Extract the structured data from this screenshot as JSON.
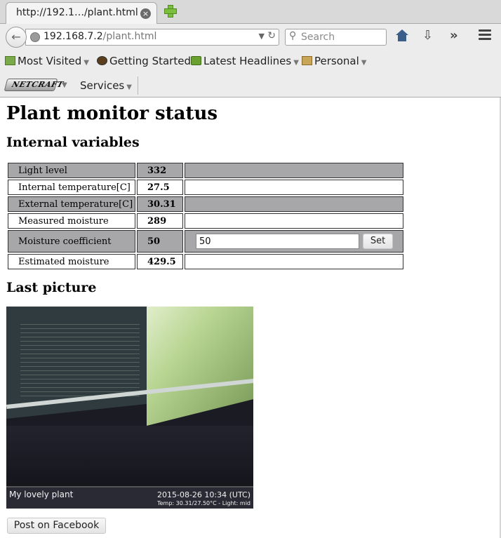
{
  "browser": {
    "tab_title": "http://192.1…/plant.html",
    "tab_close": "×",
    "url_host": "192.168.7.2",
    "url_path": "/plant.html",
    "search_placeholder": "Search",
    "bookmarks": [
      {
        "label": "Most Visited",
        "has_menu": true
      },
      {
        "label": "Getting Started",
        "has_menu": false
      },
      {
        "label": "Latest Headlines",
        "has_menu": true
      },
      {
        "label": "Personal",
        "has_menu": true
      }
    ],
    "netcraft_label": "NETCRAFT",
    "services_label": "Services",
    "icons": {
      "back": "back-arrow-icon",
      "globe": "globe-icon",
      "reload": "reload-icon",
      "search": "search-icon",
      "home": "home-icon",
      "download": "download-icon",
      "overflow": "overflow-chevron-icon",
      "menu": "hamburger-menu-icon"
    }
  },
  "page": {
    "title": "Plant monitor status",
    "section_internal": "Internal variables",
    "section_picture": "Last picture",
    "variables": [
      {
        "label": "Light level",
        "value": "332"
      },
      {
        "label": "Internal temperature[C]",
        "value": "27.5"
      },
      {
        "label": "External temperature[C]",
        "value": "30.31"
      },
      {
        "label": "Measured moisture",
        "value": "289"
      },
      {
        "label": "Moisture coefficient",
        "value": "50"
      },
      {
        "label": "Estimated moisture",
        "value": "429.5"
      }
    ],
    "coefficient_input_value": "50",
    "set_button_label": "Set",
    "picture": {
      "caption_title": "My lovely plant",
      "caption_date": "2015-08-26 10:34 (UTC)",
      "caption_temp": "Temp: 30.31/27.50°C - Light: mid"
    },
    "facebook_button_label": "Post on Facebook"
  },
  "colors": {
    "row_shade": "#a7a7a9",
    "tab_bg": "#f4f4f4",
    "chrome_bg": "#ececec"
  }
}
